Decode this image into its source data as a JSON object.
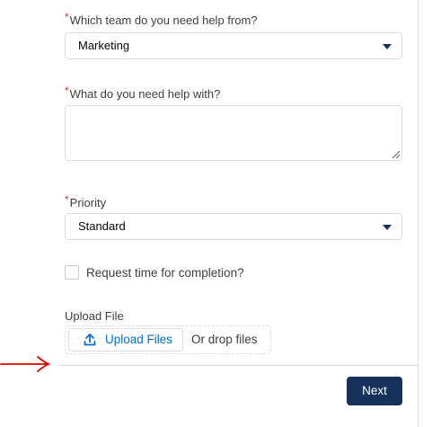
{
  "form": {
    "team_field": {
      "required_mark": "*",
      "label": "Which team do you need help from?",
      "value": "Marketing",
      "caret_icon": "caret-down-icon"
    },
    "help_field": {
      "required_mark": "*",
      "label": "What do you need help with?",
      "value": ""
    },
    "priority_field": {
      "required_mark": "*",
      "label": "Priority",
      "value": "Standard",
      "caret_icon": "caret-down-icon"
    },
    "completion_checkbox": {
      "label": "Request time for completion?",
      "checked": false
    },
    "upload": {
      "label": "Upload File",
      "button_label": "Upload Files",
      "button_icon": "upload-icon",
      "drop_text": "Or drop files"
    }
  },
  "footer": {
    "next_label": "Next"
  },
  "annotation": {
    "arrow_icon": "red-arrow-icon",
    "color": "#e00000"
  },
  "colors": {
    "brand_button": "#16325c",
    "link": "#0070d2",
    "required": "#c23934",
    "border": "#d8dde6"
  }
}
